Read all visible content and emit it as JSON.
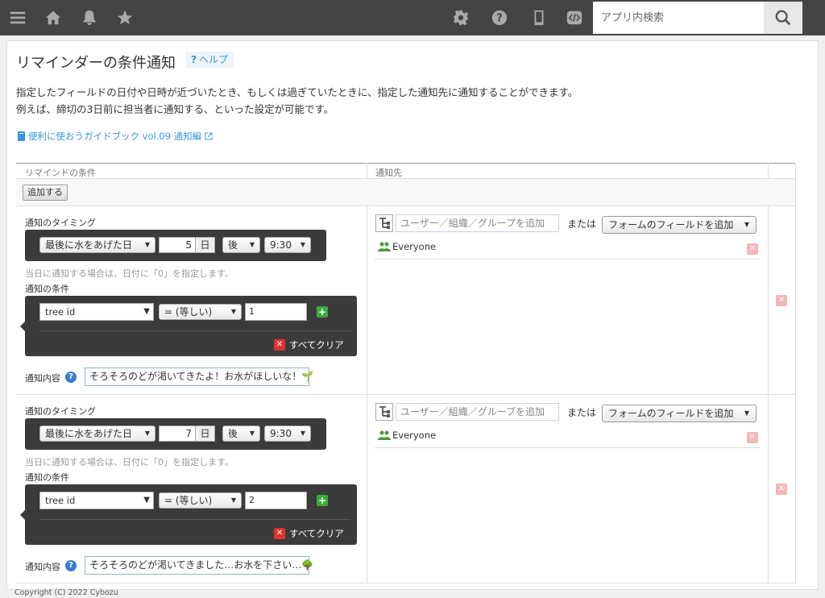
{
  "topbar": {
    "icons": [
      "menu-icon",
      "home-icon",
      "bell-icon",
      "star-icon",
      "gear-icon",
      "help-icon",
      "mobile-icon",
      "code-icon"
    ],
    "search_placeholder": "アプリ内検索"
  },
  "page": {
    "title": "リマインダーの条件通知",
    "help_label": "ヘルプ",
    "desc1": "指定したフィールドの日付や日時が近づいたとき、もしくは過ぎていたときに、指定した通知先に通知することができます。",
    "desc2": "例えば、締切の3日前に担当者に通知する、といった設定が可能です。",
    "guide_link": "便利に使おうガイドブック vol.09 通知編"
  },
  "table": {
    "col_condition": "リマインドの条件",
    "col_target": "通知先",
    "add_button": "追加する"
  },
  "labels": {
    "timing": "通知のタイミング",
    "hint": "当日に通知する場合は、日付に「0」を指定します。",
    "condition": "通知の条件",
    "clear_all": "すべてクリア",
    "message": "通知内容",
    "day_unit": "日",
    "target_placeholder": "ユーザー／組織／グループを追加",
    "or": "または",
    "form_field_add": "フォームのフィールドを追加"
  },
  "rules": [
    {
      "field": "最後に水をあげた日",
      "days": "5",
      "direction": "後",
      "time": "9:30",
      "cond_field": "tree id",
      "cond_op": "= (等しい)",
      "cond_value": "1",
      "message": "そろそろのどが渇いてきたよ！お水がほしいな！🌱",
      "target": "Everyone"
    },
    {
      "field": "最後に水をあげた日",
      "days": "7",
      "direction": "後",
      "time": "9:30",
      "cond_field": "tree id",
      "cond_op": "= (等しい)",
      "cond_value": "2",
      "message": "そろそろのどが渇いてきました…お水を下さい…🌳",
      "target": "Everyone"
    }
  ],
  "footer": "Copyright (C) 2022 Cybozu"
}
